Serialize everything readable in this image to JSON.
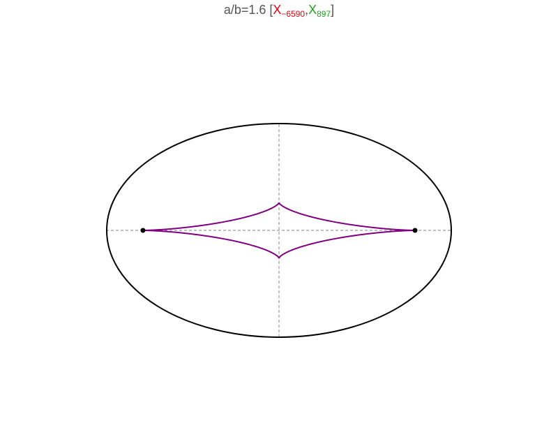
{
  "title": {
    "prefix": "a/b=1.6 [",
    "red_symbol": "X",
    "red_index": "−6590",
    "separator": ",",
    "green_symbol": "X",
    "green_index": "897",
    "suffix": "]"
  },
  "colors": {
    "title_text": "#555555",
    "red": "#e8000b",
    "green": "#1aa51a",
    "ellipse": "#000000",
    "astroid": "#800080",
    "axes": "#999999",
    "points": "#000000"
  },
  "figure": {
    "axis_ratio": 1.6,
    "curves": [
      "ellipse",
      "stretched-astroid"
    ],
    "marked_points": [
      "left-focus",
      "right-focus"
    ],
    "axes_style": "dashed"
  }
}
